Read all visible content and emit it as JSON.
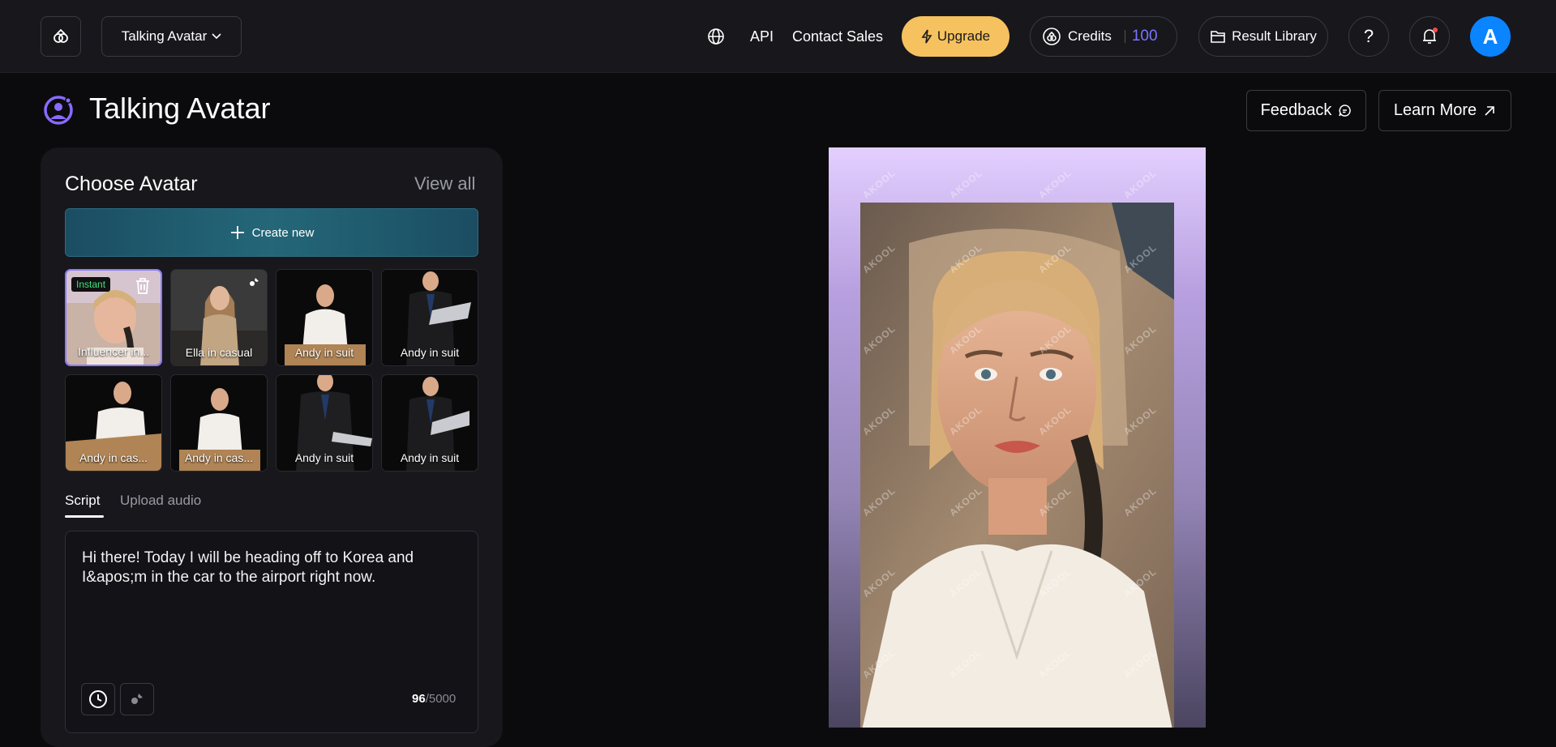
{
  "header": {
    "product_select": "Talking Avatar",
    "api": "API",
    "contact_sales": "Contact Sales",
    "upgrade": "Upgrade",
    "credits_label": "Credits",
    "credits_value": "100",
    "result_library": "Result Library",
    "help": "?",
    "avatar_initial": "A"
  },
  "page": {
    "title": "Talking Avatar",
    "feedback": "Feedback",
    "learn_more": "Learn More"
  },
  "avatar_panel": {
    "heading": "Choose Avatar",
    "view_all": "View all",
    "create_new": "Create new",
    "instant_badge": "Instant",
    "avatars": [
      {
        "label": "Influencer in..."
      },
      {
        "label": "Ella in casual"
      },
      {
        "label": "Andy in suit"
      },
      {
        "label": "Andy in suit"
      },
      {
        "label": "Andy in cas..."
      },
      {
        "label": "Andy in cas..."
      },
      {
        "label": "Andy in suit"
      },
      {
        "label": "Andy in suit"
      }
    ]
  },
  "script": {
    "tab_script": "Script",
    "tab_upload": "Upload audio",
    "text": "Hi there! Today I will be heading off to Korea and I&apos;m in the car to the airport right now.",
    "count": "96",
    "max": "/5000"
  },
  "preview": {
    "watermark": "AKOOL"
  },
  "colors": {
    "accent": "#7b74ff",
    "upgrade": "#f6c15f",
    "avatar_bg": "#0a84ff"
  }
}
